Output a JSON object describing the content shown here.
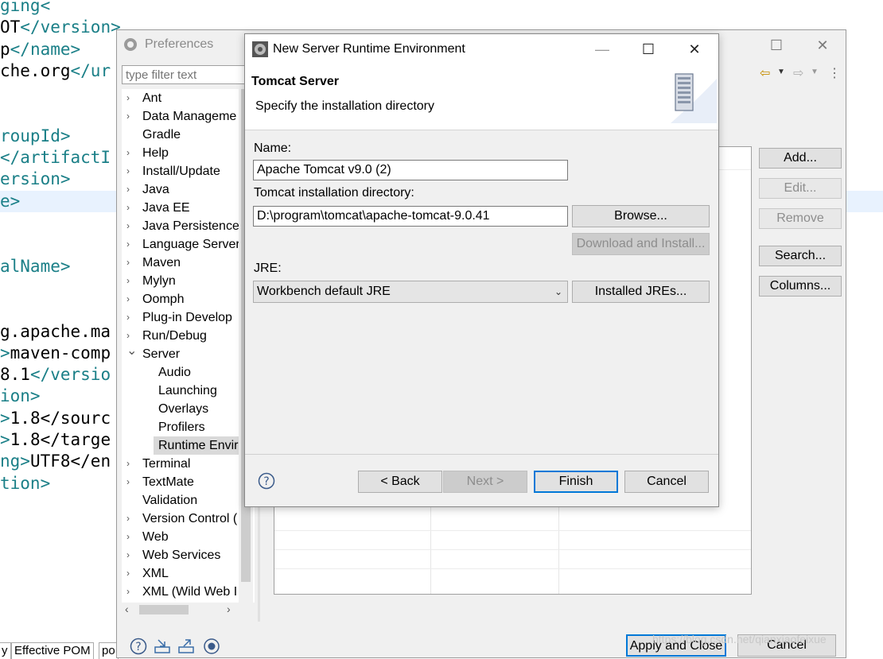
{
  "editor": {
    "lines": [
      {
        "pre": "",
        "tag": "ging<",
        "post": ""
      },
      {
        "pre": "OT",
        "tag": "</version>",
        "post": ""
      },
      {
        "pre": "p",
        "tag": "</name>",
        "post": ""
      },
      {
        "pre": "che.org",
        "tag": "</ur",
        "post": ""
      },
      {
        "pre": "",
        "tag": "",
        "post": ""
      },
      {
        "pre": "",
        "tag": "",
        "post": ""
      },
      {
        "pre": "",
        "tag": "roupId>",
        "post": ""
      },
      {
        "pre": "",
        "tag": "</artifactI",
        "post": ""
      },
      {
        "pre": "",
        "tag": "ersion>",
        "post": ""
      },
      {
        "pre": "",
        "tag": "e>",
        "post": ""
      },
      {
        "pre": "",
        "tag": "",
        "post": ""
      },
      {
        "pre": "",
        "tag": "",
        "post": ""
      },
      {
        "pre": "",
        "tag": "alName>",
        "post": ""
      },
      {
        "pre": "",
        "tag": "",
        "post": ""
      },
      {
        "pre": "",
        "tag": "",
        "post": ""
      },
      {
        "pre": "g.apache.ma",
        "tag": "",
        "post": ""
      },
      {
        "pre": "",
        "tag": ">",
        "post": "maven-comp"
      },
      {
        "pre": "8.1",
        "tag": "</versio",
        "post": ""
      },
      {
        "pre": "",
        "tag": "ion>",
        "post": ""
      },
      {
        "pre": "",
        "tag": ">",
        "post": "1.8</sourc"
      },
      {
        "pre": "",
        "tag": ">",
        "post": "1.8</targe"
      },
      {
        "pre": "",
        "tag": "ng>",
        "post": "UTF8</en"
      },
      {
        "pre": "",
        "tag": "tion>",
        "post": ""
      }
    ],
    "bottom_tabs": [
      "y",
      "Effective POM",
      "po"
    ]
  },
  "prefs": {
    "title": "Preferences",
    "filter_placeholder": "type filter text",
    "tree": [
      {
        "label": "Ant",
        "chev": "›",
        "level": 0
      },
      {
        "label": "Data Manageme",
        "chev": "›",
        "level": 0
      },
      {
        "label": "Gradle",
        "chev": "",
        "level": 0
      },
      {
        "label": "Help",
        "chev": "›",
        "level": 0
      },
      {
        "label": "Install/Update",
        "chev": "›",
        "level": 0
      },
      {
        "label": "Java",
        "chev": "›",
        "level": 0
      },
      {
        "label": "Java EE",
        "chev": "›",
        "level": 0
      },
      {
        "label": "Java Persistence",
        "chev": "›",
        "level": 0
      },
      {
        "label": "Language Server",
        "chev": "›",
        "level": 0
      },
      {
        "label": "Maven",
        "chev": "›",
        "level": 0
      },
      {
        "label": "Mylyn",
        "chev": "›",
        "level": 0
      },
      {
        "label": "Oomph",
        "chev": "›",
        "level": 0
      },
      {
        "label": "Plug-in Develop",
        "chev": "›",
        "level": 0
      },
      {
        "label": "Run/Debug",
        "chev": "›",
        "level": 0
      },
      {
        "label": "Server",
        "chev": "⌄",
        "level": 0
      },
      {
        "label": "Audio",
        "chev": "",
        "level": 1
      },
      {
        "label": "Launching",
        "chev": "",
        "level": 1
      },
      {
        "label": "Overlays",
        "chev": "",
        "level": 1
      },
      {
        "label": "Profilers",
        "chev": "",
        "level": 1
      },
      {
        "label": "Runtime Envir",
        "chev": "",
        "level": 1,
        "selected": true
      },
      {
        "label": "Terminal",
        "chev": "›",
        "level": 0
      },
      {
        "label": "TextMate",
        "chev": "›",
        "level": 0
      },
      {
        "label": "Validation",
        "chev": "",
        "level": 0
      },
      {
        "label": "Version Control (",
        "chev": "›",
        "level": 0
      },
      {
        "label": "Web",
        "chev": "›",
        "level": 0
      },
      {
        "label": "Web Services",
        "chev": "›",
        "level": 0
      },
      {
        "label": "XML",
        "chev": "›",
        "level": 0
      },
      {
        "label": "XML (Wild Web I",
        "chev": "›",
        "level": 0
      }
    ],
    "side_buttons": {
      "add": "Add...",
      "edit": "Edit...",
      "remove": "Remove",
      "search": "Search...",
      "columns": "Columns..."
    },
    "apply_close": "Apply and Close",
    "cancel": "Cancel"
  },
  "dialog": {
    "title": "New Server Runtime Environment",
    "header_title": "Tomcat Server",
    "header_desc": "Specify the installation directory",
    "name_label": "Name:",
    "name_value": "Apache Tomcat v9.0 (2)",
    "dir_label": "Tomcat installation directory:",
    "dir_value": "D:\\program\\tomcat\\apache-tomcat-9.0.41",
    "browse": "Browse...",
    "download": "Download and Install...",
    "jre_label": "JRE:",
    "jre_value": "Workbench default JRE",
    "installed_jres": "Installed JREs...",
    "back": "< Back",
    "next": "Next >",
    "finish": "Finish",
    "cancel": "Cancel"
  },
  "watermark": "https://blog.csdn.net/qianxiaofeixue"
}
